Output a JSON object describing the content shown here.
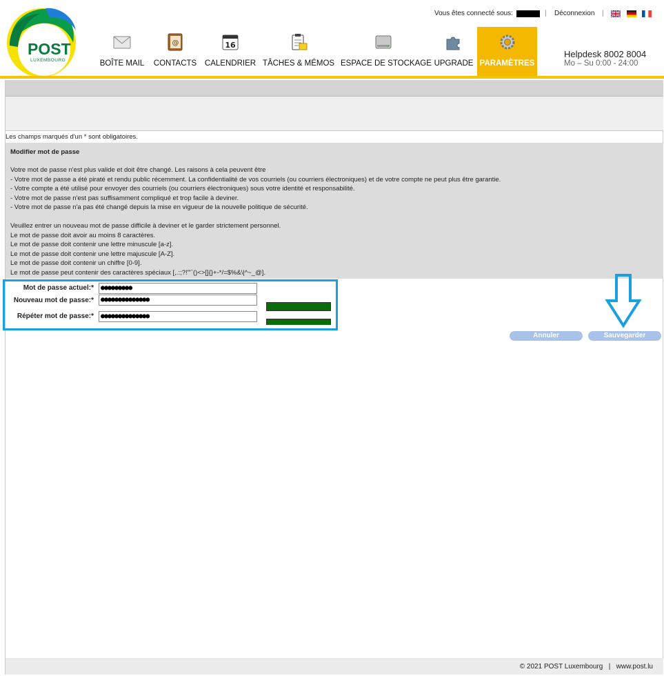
{
  "logo": {
    "title": "POST",
    "subtitle": "LUXEMBOURG"
  },
  "topbar": {
    "connected_label": "Vous êtes connecté sous:",
    "separator": "|",
    "logout": "Déconnexion",
    "languages": [
      "English",
      "Deutsch",
      "Français"
    ]
  },
  "nav": [
    {
      "label": "BOÎTE MAIL",
      "icon": "envelope-icon"
    },
    {
      "label": "CONTACTS",
      "icon": "address-book-icon"
    },
    {
      "label": "CALENDRIER",
      "icon": "calendar-icon",
      "day": "16"
    },
    {
      "label": "TÂCHES & MÉMOS",
      "icon": "clipboard-icon"
    },
    {
      "label": "ESPACE DE STOCKAGE",
      "icon": "hard-drive-icon"
    },
    {
      "label": "UPGRADE",
      "icon": "puzzle-icon"
    },
    {
      "label": "PARAMÈTRES",
      "icon": "gear-icon",
      "active": true
    }
  ],
  "helpdesk": {
    "title": "Helpdesk 8002 8004",
    "hours": "Mo – Su 0:00 - 24:00"
  },
  "required_note": "Les champs marqués d'un * sont obligatoires.",
  "info": {
    "title": "Modifier mot de passe",
    "lines": [
      "Votre mot de passe n'est plus valide et doit être changé. Les raisons à cela peuvent être",
      "- Votre mot de passe a été piraté et rendu public récemment. La confidentialité de vos courriels (ou courriers électroniques) et de votre compte ne peut plus être garantie.",
      "- Votre compte a été utilisé pour envoyer des courriels (ou courriers électroniques) sous votre identité et responsabilité.",
      "- Votre mot de passe n'est pas suffisamment compliqué et trop facile à deviner.",
      "- Votre mot de passe n'a pas été changé depuis la mise en vigueur de la nouvelle politique de sécurité.",
      "Veuillez entrer un nouveau mot de passe difficile à deviner et le garder strictement personnel.",
      "Le mot de passe doit avoir au moins 8 caractères.",
      "Le mot de passe doit contenir une lettre minuscule [a-z].",
      "Le mot de passe doit contenir une lettre majuscule [A-Z].",
      "Le mot de passe doit contenir un chiffre [0-9].",
      "Le mot de passe peut contenir des caractères spéciaux [,.:;?!\"'`()<>[]{}+-*/=$%&\\|^~_@]."
    ]
  },
  "form": {
    "current": {
      "label": "Mot de passe actuel:*",
      "value": "●●●●●●●●●"
    },
    "new": {
      "label": "Nouveau mot de passe:*",
      "value": "●●●●●●●●●●●●●●"
    },
    "repeat": {
      "label": "Répéter mot de passe:*",
      "value": "●●●●●●●●●●●●●●"
    }
  },
  "buttons": {
    "cancel": "Annuler",
    "save": "Sauvegarder"
  },
  "footer": "© 2021 POST Luxembourg   |   www.post.lu",
  "colors": {
    "accent": "#f5b800",
    "brand_green": "#0a7b3e",
    "highlight": "#1aa0e0",
    "strength": "#0a6b0a",
    "button": "#a9c3e8"
  }
}
